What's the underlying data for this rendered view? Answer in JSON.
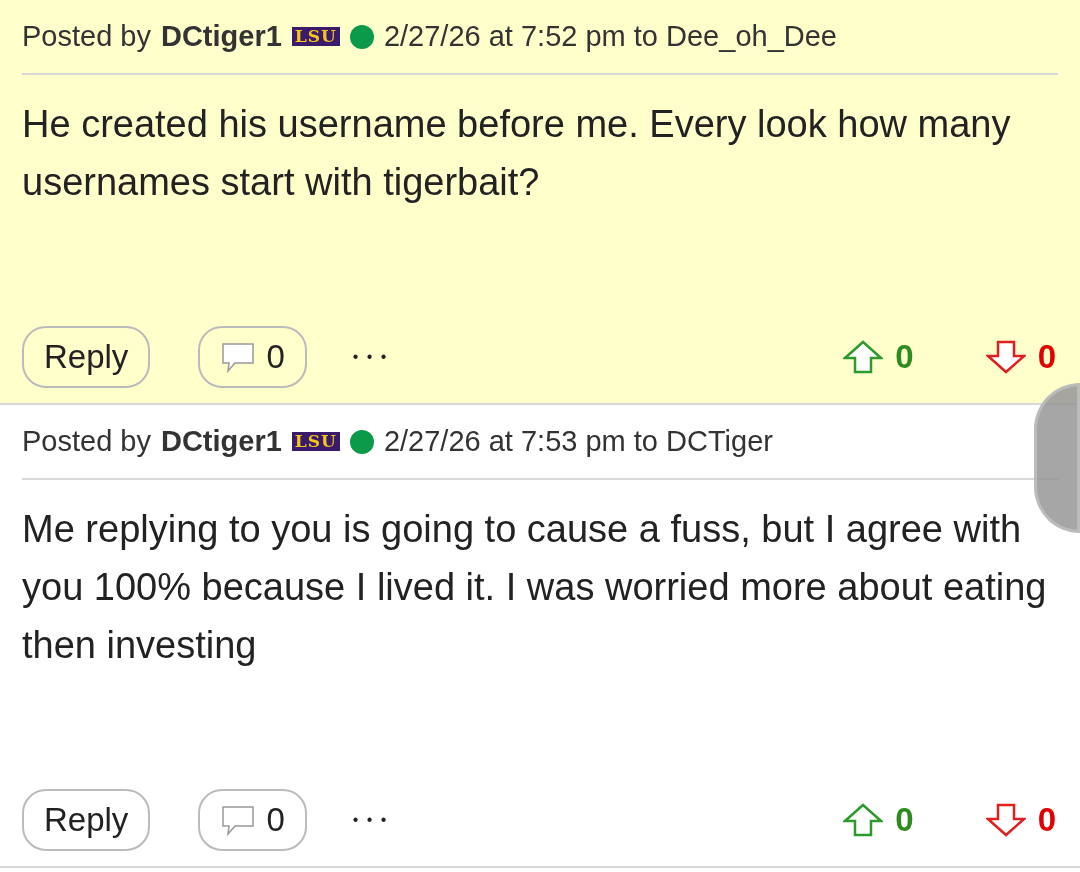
{
  "posts": [
    {
      "highlighted": true,
      "posted_by": "Posted by",
      "author": "DCtiger1",
      "team_badge": "LSU",
      "online": true,
      "timestamp": "2/27/26 at 7:52 pm to Dee_oh_Dee",
      "body": "He created his username before me. Every look how many usernames start with tigerbait?",
      "reply_label": "Reply",
      "comment_count": "0",
      "more": "• • •",
      "upvotes": "0",
      "downvotes": "0"
    },
    {
      "highlighted": false,
      "posted_by": "Posted by",
      "author": "DCtiger1",
      "team_badge": "LSU",
      "online": true,
      "timestamp": "2/27/26 at 7:53 pm to DCTiger",
      "body": "Me replying to you is going to cause a fuss, but I agree with you 100% because I lived it. I was worried more about eating then investing",
      "reply_label": "Reply",
      "comment_count": "0",
      "more": "• • •",
      "upvotes": "0",
      "downvotes": "0"
    }
  ]
}
